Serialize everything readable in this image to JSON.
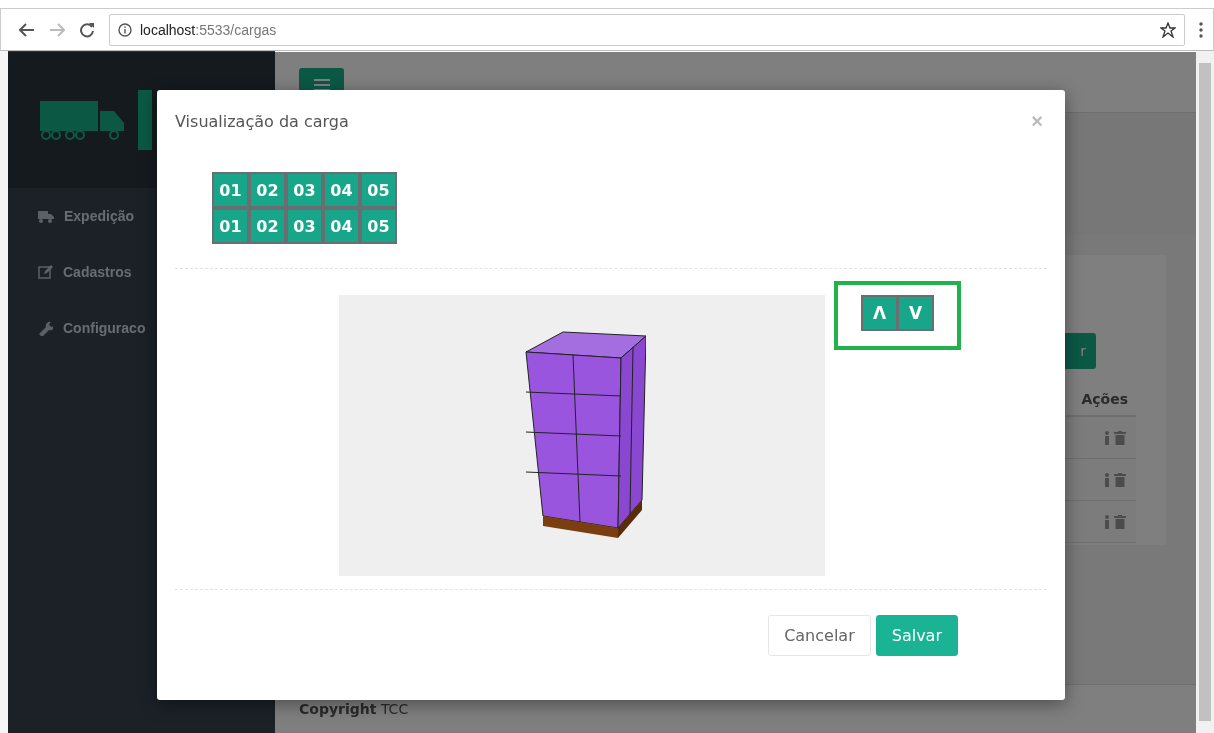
{
  "browser": {
    "url_host": "localhost",
    "url_rest": ":5533/cargas"
  },
  "sidebar": {
    "items": [
      {
        "kind": "truck",
        "label": "Expedição"
      },
      {
        "kind": "edit",
        "label": "Cadastros"
      },
      {
        "kind": "wrench",
        "label": "Configuraco"
      }
    ]
  },
  "main": {
    "action_button": "r",
    "table": {
      "actions_header": "Ações",
      "rows": [
        {
          "kind": "actions"
        },
        {
          "kind": "actions"
        },
        {
          "kind": "actions"
        }
      ]
    },
    "footer": "**Copyright** TCC"
  },
  "modal": {
    "title": "Visualização da carga",
    "close": "×",
    "grid": [
      [
        "01",
        "02",
        "03",
        "04",
        "05"
      ],
      [
        "01",
        "02",
        "03",
        "04",
        "05"
      ]
    ],
    "layer_buttons": [
      "Λ",
      "V"
    ],
    "buttons": [
      {
        "kind": "default",
        "label": "Cancelar"
      },
      {
        "kind": "primary",
        "label": "Salvar"
      }
    ]
  }
}
